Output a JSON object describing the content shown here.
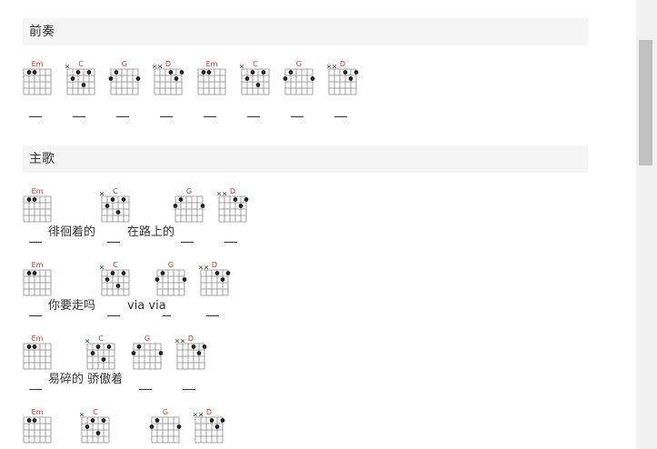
{
  "sections": {
    "prelude": "前奏",
    "verse": "主歌"
  },
  "chords": {
    "Em": {
      "name": "Em",
      "muted": [],
      "dots": [
        [
          1,
          1
        ],
        [
          2,
          1
        ]
      ]
    },
    "C": {
      "name": "C",
      "muted": [
        0
      ],
      "dots": [
        [
          1,
          2
        ],
        [
          2,
          1
        ],
        [
          3,
          3
        ],
        [
          4,
          1
        ]
      ]
    },
    "G": {
      "name": "G",
      "muted": [],
      "dots": [
        [
          0,
          2
        ],
        [
          1,
          1
        ],
        [
          5,
          2
        ]
      ]
    },
    "D": {
      "name": "D",
      "muted": [
        0,
        1
      ],
      "dots": [
        [
          3,
          1
        ],
        [
          4,
          2
        ],
        [
          5,
          1
        ]
      ]
    }
  },
  "prelude_sequence": [
    "Em",
    "C",
    "G",
    "D",
    "Em",
    "C",
    "G",
    "D"
  ],
  "verse_lines": [
    {
      "chords": [
        "Em",
        "C",
        "G",
        "D"
      ],
      "lyrics": [
        "徘徊着的",
        "在路上的"
      ]
    },
    {
      "chords": [
        "Em",
        "C",
        "G",
        "D"
      ],
      "lyrics": [
        "你要走吗",
        "via via"
      ]
    },
    {
      "chords": [
        "Em",
        "C",
        "G",
        "D"
      ],
      "lyrics": [
        "易碎的 骄傲着"
      ]
    },
    {
      "chords": [
        "Em",
        "C",
        "G",
        "D"
      ],
      "lyrics": []
    }
  ]
}
